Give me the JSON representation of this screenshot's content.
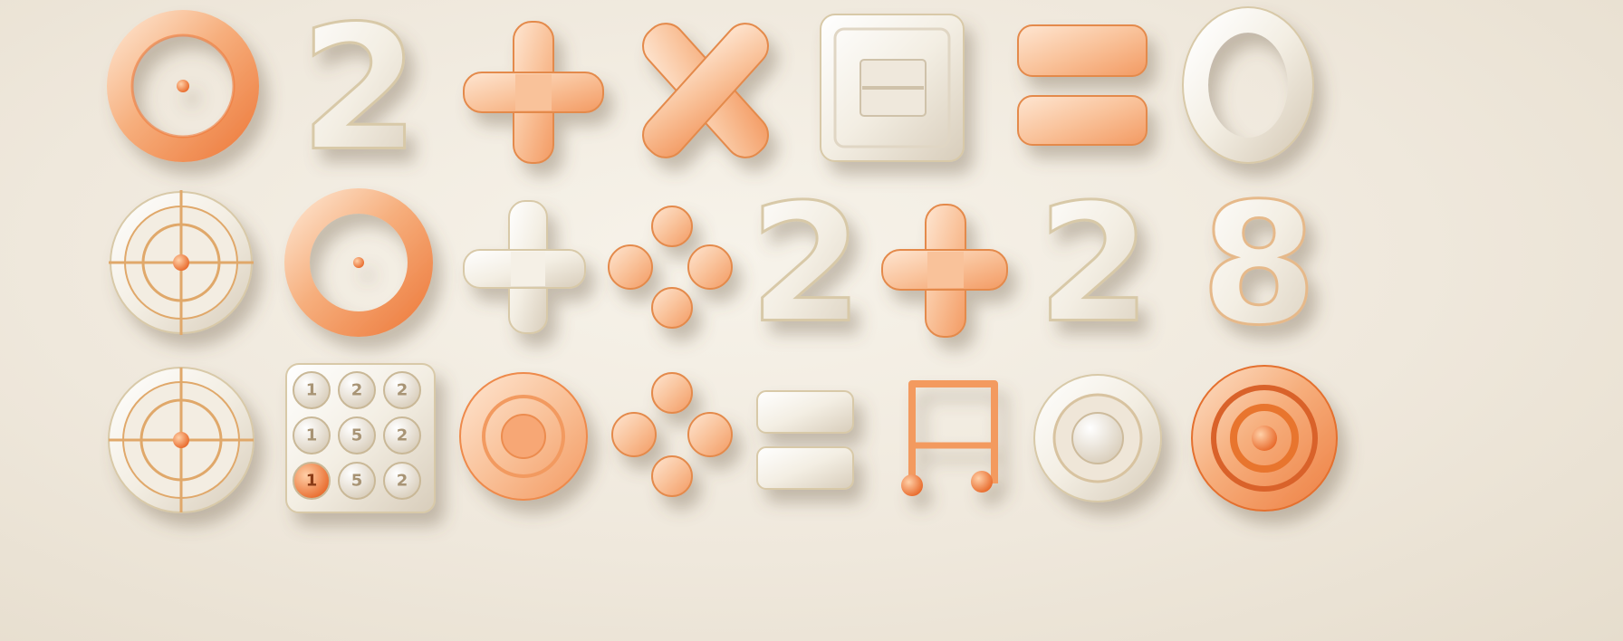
{
  "scene": {
    "description_tags": [
      "math-symbols",
      "3d-clay-style"
    ],
    "colors": {
      "background": "#efe8dc",
      "orange": "#f4a574",
      "orange_dark": "#ef7a3a",
      "orange_light": "#fbc9a2",
      "cream": "#f4efe4",
      "cream_shadow": "#d9cfbf",
      "outline_gold": "#d8a35e"
    }
  },
  "row1": {
    "digit_2": "2"
  },
  "row2": {
    "digit_2a": "2",
    "digit_2b": "2",
    "digit_8": "8"
  },
  "row3": {
    "keypad_keys": [
      "1",
      "2",
      "2",
      "1",
      "5",
      "2",
      "1",
      "5",
      "2"
    ]
  }
}
